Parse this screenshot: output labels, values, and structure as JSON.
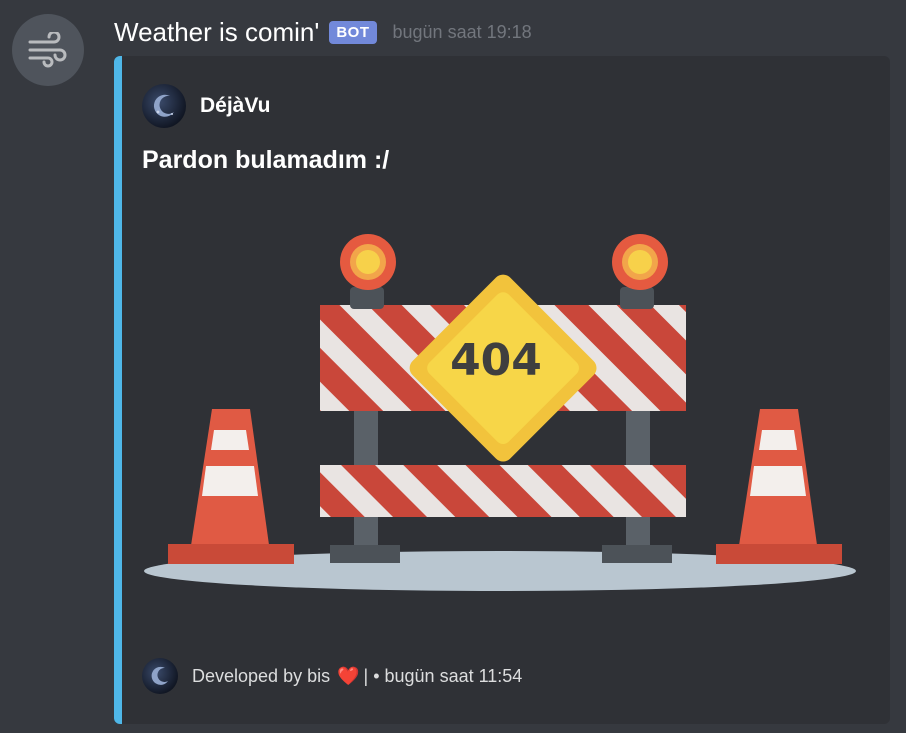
{
  "message": {
    "author": "Weather is comin'",
    "bot_tag": "BOT",
    "timestamp": "bugün saat 19:18",
    "avatar_icon": "wind-icon"
  },
  "embed": {
    "accent_color": "#4fb7e8",
    "author_name": "DéjàVu",
    "author_icon": "crescent-moon-icon",
    "title": "Pardon bulamadım :/",
    "image": {
      "sign_text": "404",
      "icon": "road-barrier-404-illustration"
    },
    "footer": {
      "text_prefix": "Developed by bis",
      "heart": "❤️",
      "text_suffix": "| • bugün saat 11:54"
    }
  }
}
